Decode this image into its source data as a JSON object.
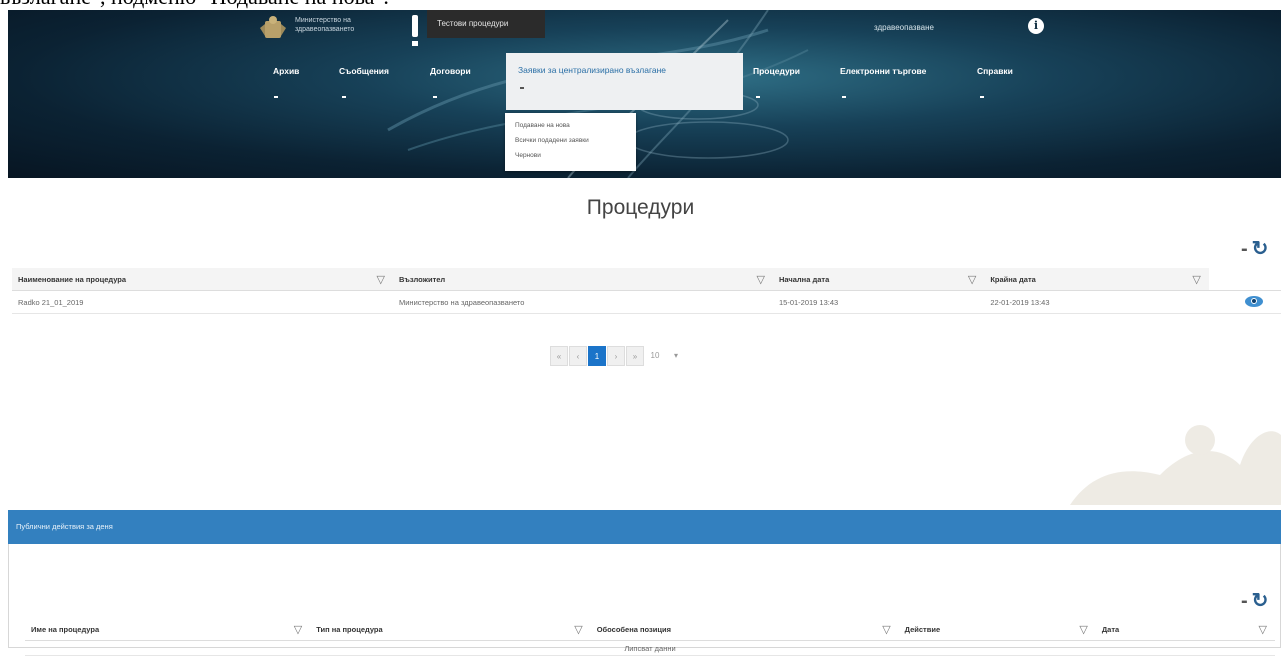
{
  "caption_text": "възлагане\", подменю \"Подаване на нова\".",
  "header": {
    "logo_text": "Министерство на здравеопазването",
    "procedure_badge": "Тестови процедури",
    "user_link": "здравеопазване",
    "info_icon": "i",
    "nav": [
      {
        "label": "Архив"
      },
      {
        "label": "Съобщения"
      },
      {
        "label": "Договори"
      },
      {
        "label": "Заявки за централизирано възлагане"
      },
      {
        "label": "Процедури"
      },
      {
        "label": "Електронни търгове"
      },
      {
        "label": "Справки"
      }
    ],
    "dropdown": [
      "Подаване на нова",
      "Всички подадени заявки",
      "Чернови"
    ],
    "colors": {
      "active_link": "#2a6fa6",
      "banner_dark": "#0b2233"
    }
  },
  "procedures": {
    "title": "Процедури",
    "toolbar": {
      "minus": "-",
      "refresh": "↻"
    },
    "columns": [
      "Наименование на процедура",
      "Възложител",
      "Начална дата",
      "Крайна дата"
    ],
    "filter_icon": "▽",
    "rows": [
      {
        "name": "Radko 21_01_2019",
        "contracting": "Министерство на здравеопазването",
        "start": "15-01-2019 13:43",
        "end": "22-01-2019 13:43"
      }
    ],
    "pager": {
      "first": "«",
      "prev": "‹",
      "current": "1",
      "next": "›",
      "last": "»",
      "page_size": "10",
      "size_toggle": "▾"
    }
  },
  "today_panel": {
    "title": "Публични действия за деня",
    "toolbar": {
      "minus": "-",
      "refresh": "↻"
    },
    "columns": [
      "Име на процедура",
      "Тип на процедура",
      "Обособена позиция",
      "Действие",
      "Дата"
    ],
    "filter_icon": "▽",
    "empty_text": "Липсват данни"
  }
}
